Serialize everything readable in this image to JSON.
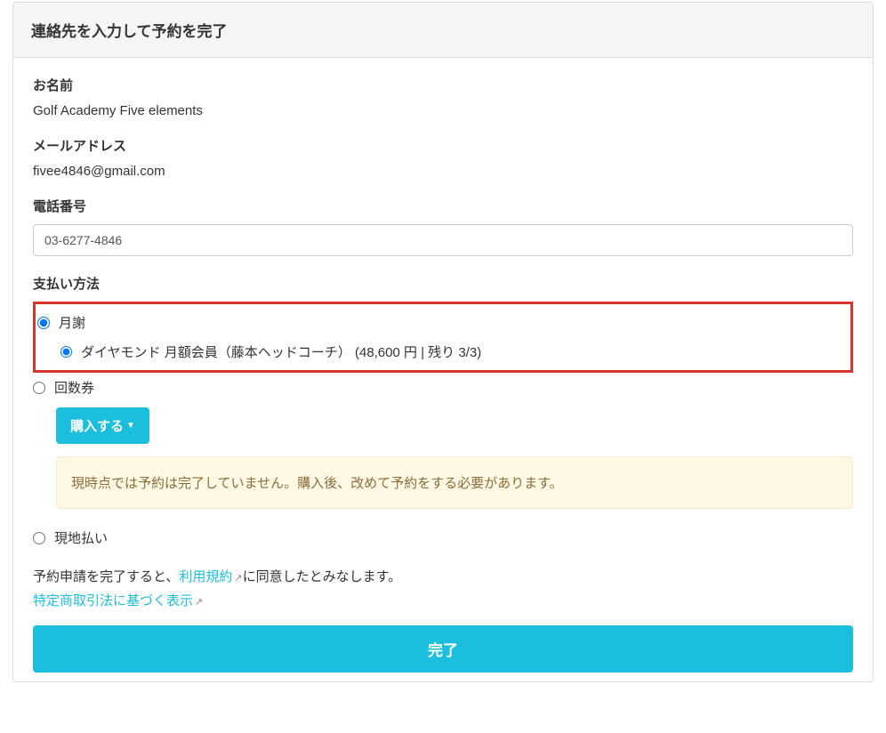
{
  "panel": {
    "title": "連絡先を入力して予約を完了"
  },
  "name": {
    "label": "お名前",
    "value": "Golf Academy Five elements"
  },
  "email": {
    "label": "メールアドレス",
    "value": "fivee4846@gmail.com"
  },
  "phone": {
    "label": "電話番号",
    "value": "03-6277-4846"
  },
  "payment": {
    "label": "支払い方法",
    "monthly": {
      "label": "月謝",
      "sub": "ダイヤモンド 月額会員（藤本ヘッドコーチ） (48,600 円 | 残り 3/3)"
    },
    "coupon": {
      "label": "回数券",
      "purchase_button": "購入する",
      "warning": "現時点では予約は完了していません。購入後、改めて予約をする必要があります。"
    },
    "onsite": {
      "label": "現地払い"
    }
  },
  "terms": {
    "prefix": "予約申請を完了すると、",
    "link1": "利用規約",
    "suffix": "に同意したとみなします。",
    "link2": "特定商取引法に基づく表示"
  },
  "complete_button": "完了"
}
